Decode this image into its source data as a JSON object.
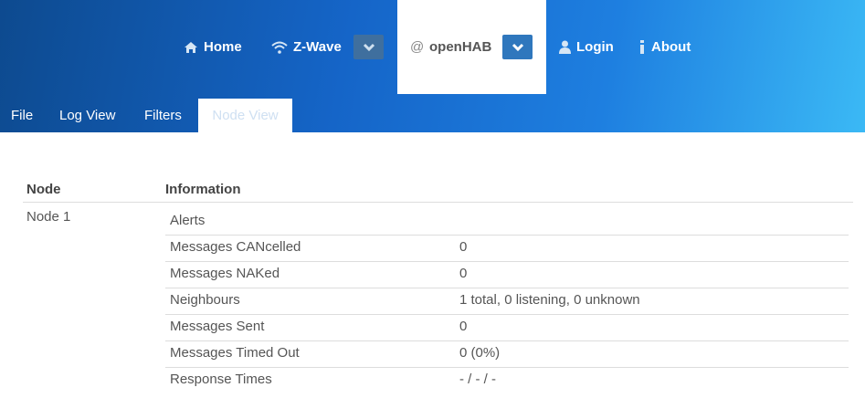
{
  "nav": {
    "home": "Home",
    "zwave": "Z-Wave",
    "openhab_at": "@",
    "openhab": "openHAB",
    "login": "Login",
    "about": "About"
  },
  "tabs": [
    "File",
    "Log View",
    "Filters",
    "Node View"
  ],
  "active_tab": "Node View",
  "table": {
    "headers": {
      "node": "Node",
      "information": "Information"
    },
    "node": "Node 1",
    "rows": [
      {
        "label": "Alerts",
        "value": ""
      },
      {
        "label": "Messages CANcelled",
        "value": "0"
      },
      {
        "label": "Messages NAKed",
        "value": "0"
      },
      {
        "label": "Neighbours",
        "value": "1 total, 0 listening, 0 unknown"
      },
      {
        "label": "Messages Sent",
        "value": "0"
      },
      {
        "label": "Messages Timed Out",
        "value": "0 (0%)"
      },
      {
        "label": "Response Times",
        "value": "- / - / -"
      }
    ]
  },
  "colors": {
    "header_dark": "#0d4a8f",
    "header_light": "#3bb9f5",
    "dropdown_blue": "#2f77bd"
  },
  "icons": [
    "home-icon",
    "wifi-icon",
    "chevron-down-icon",
    "user-icon",
    "info-icon"
  ]
}
